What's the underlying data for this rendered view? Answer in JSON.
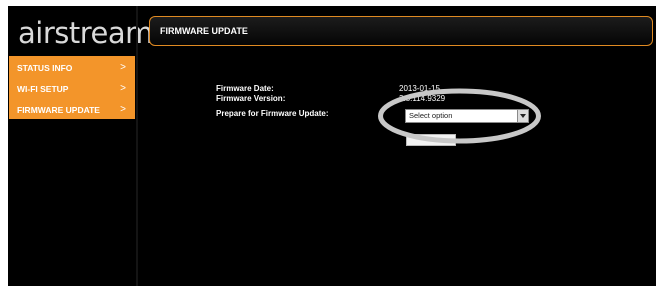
{
  "brand": {
    "logo_text": "airstream"
  },
  "sidebar": {
    "accent_color": "#f3952a",
    "items": [
      {
        "label": "STATUS INFO",
        "chevron": ">"
      },
      {
        "label": "WI-FI SETUP",
        "chevron": ">"
      },
      {
        "label": "FIRMWARE UPDATE",
        "chevron": ">"
      }
    ]
  },
  "header": {
    "title": "FIRMWARE UPDATE"
  },
  "firmware": {
    "date_label": "Firmware Date:",
    "date_value": "2013-01-15",
    "version_label": "Firmware Version:",
    "version_value": "3.8.114.9329",
    "prepare_label": "Prepare for Firmware Update:",
    "select_value": "Select option"
  },
  "colors": {
    "background": "#000000",
    "header_border": "#e08a22",
    "annotation_ring": "#c8c8c8"
  }
}
